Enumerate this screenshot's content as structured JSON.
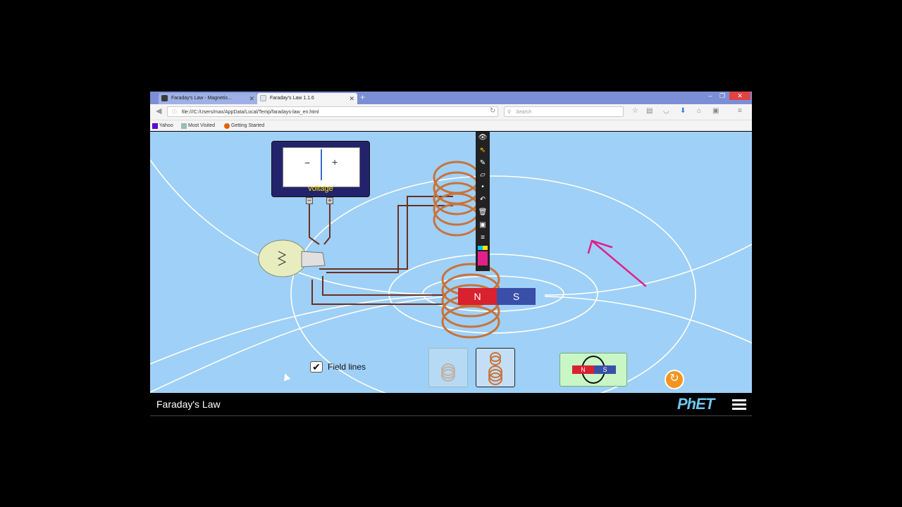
{
  "browser": {
    "tabs": [
      {
        "label": "Faraday's Law - Magnetis...",
        "active": false
      },
      {
        "label": "Faraday's Law 1.1.6",
        "active": true
      }
    ],
    "new_tab_label": "+",
    "url": "file:///C:/Users/max/AppData/Local/Temp/faradays-law_en.html",
    "search_placeholder": "Search",
    "bookmarks": [
      "Yahoo",
      "Most Visited",
      "Getting Started"
    ]
  },
  "sim": {
    "voltmeter": {
      "minus": "−",
      "plus": "+",
      "label": "voltage",
      "terminal_minus": "−",
      "terminal_plus": "+"
    },
    "magnet": {
      "north": "N",
      "south": "S",
      "north_color": "#d9212f",
      "south_color": "#3a4fa8"
    },
    "field_lines": {
      "label": "Field lines",
      "checked": true,
      "check_mark": "✔"
    },
    "flip_button": {
      "north": "N",
      "south": "S"
    },
    "reset_icon": "↻",
    "colors": {
      "background": "#9fd0f7",
      "coil": "#c8733a",
      "wire": "#6b2f20",
      "annotation": "#e0218a"
    }
  },
  "annotation_toolbar": {
    "tools": [
      "eye-icon",
      "pointer-icon",
      "pen-icon",
      "eraser-icon",
      "dot-icon",
      "undo-icon",
      "trash-icon",
      "camera-icon",
      "list-icon",
      "palette-icon"
    ]
  },
  "footer": {
    "title": "Faraday's Law",
    "logo": {
      "main": "PhET",
      "accent": "E"
    }
  }
}
